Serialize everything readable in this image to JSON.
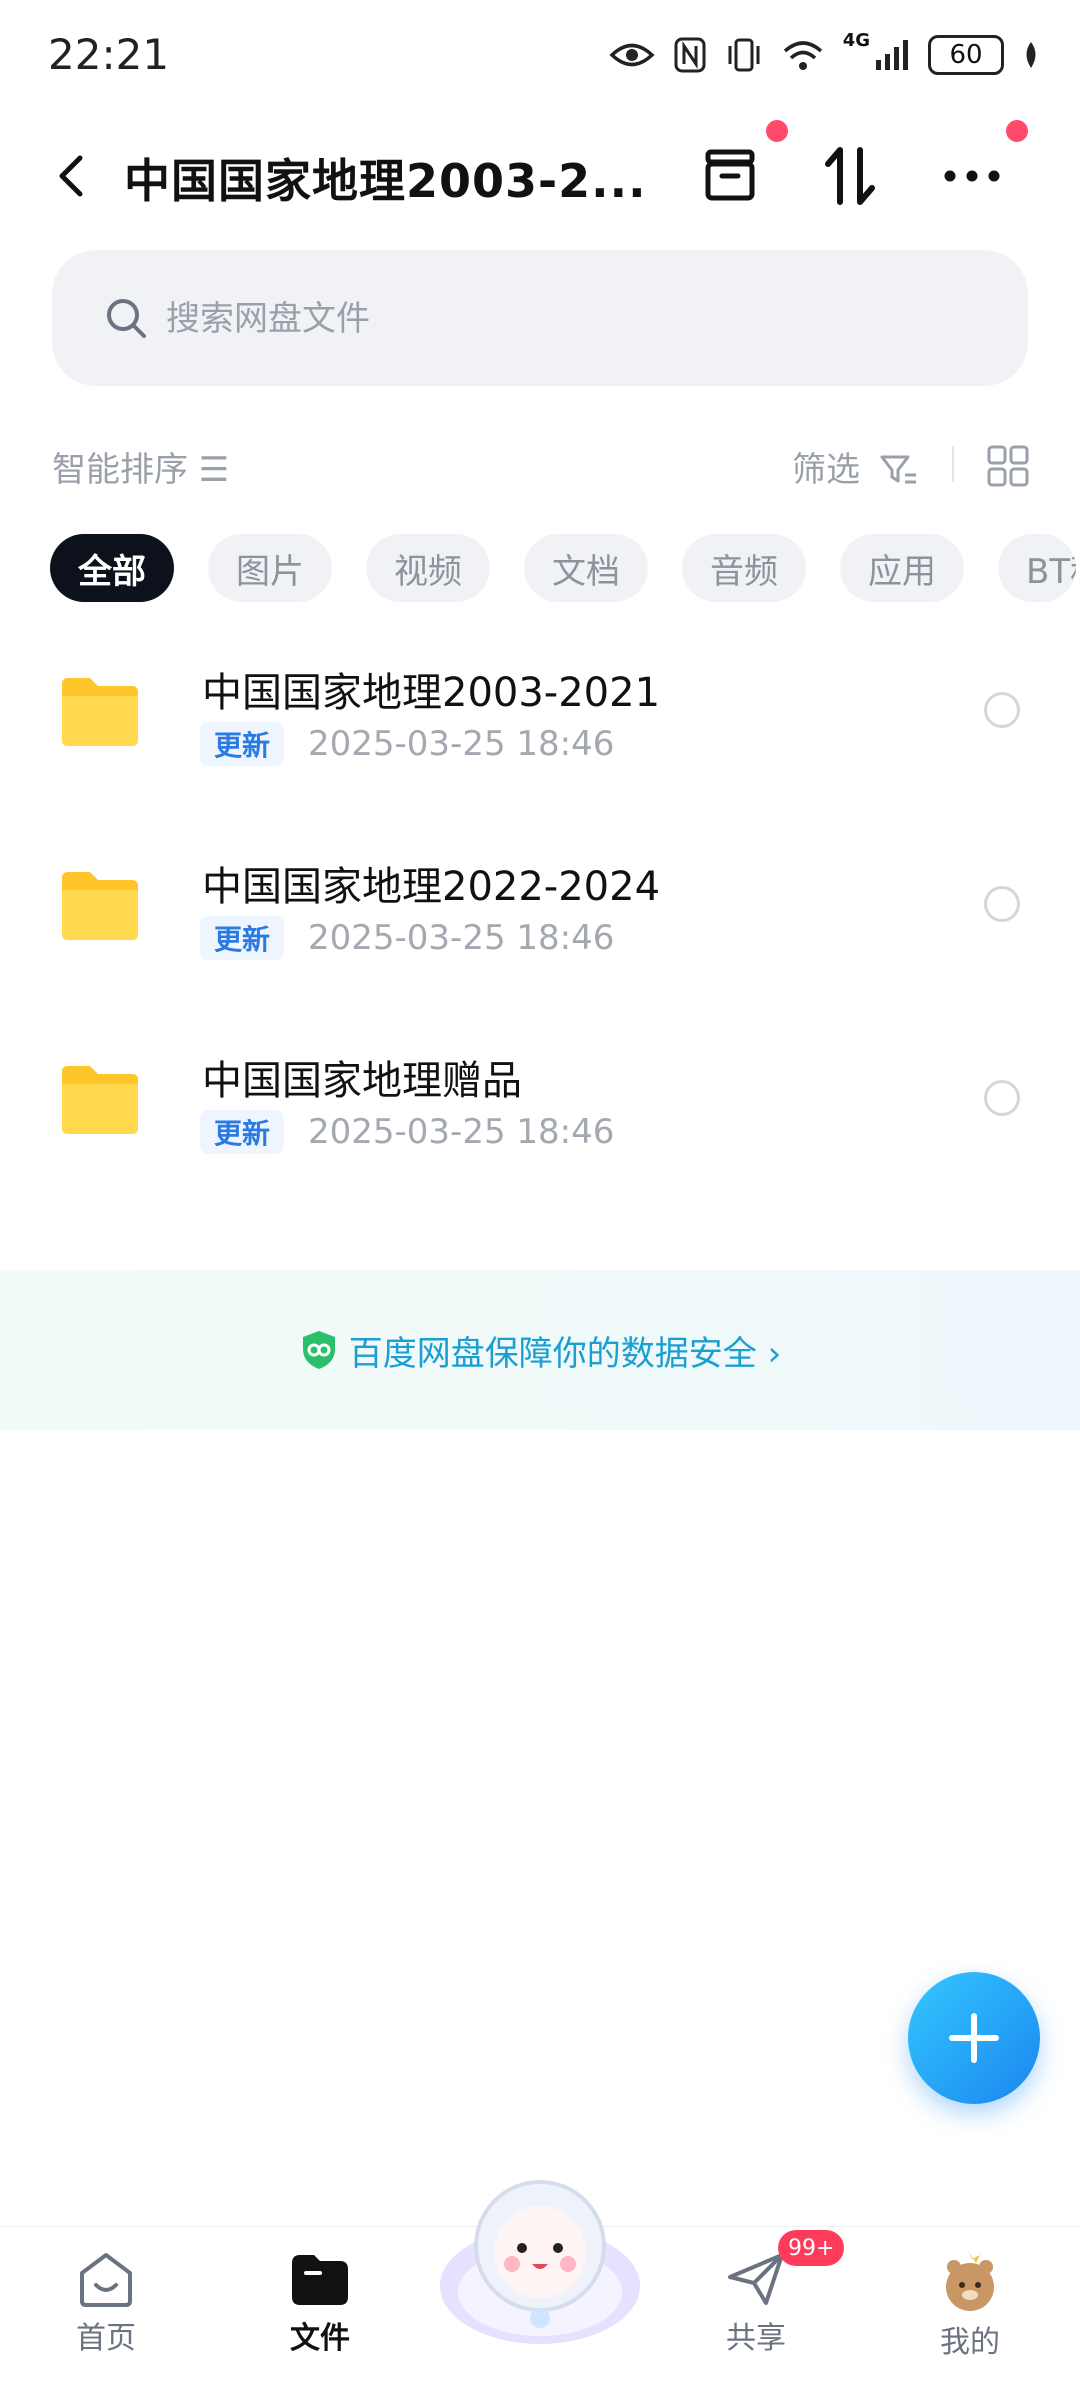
{
  "status_bar": {
    "time": "22:21",
    "network": "4G",
    "battery": "60"
  },
  "header": {
    "title": "中国国家地理2003-2..."
  },
  "search": {
    "placeholder": "搜索网盘文件"
  },
  "toolbar": {
    "sort_label": "智能排序 ☰",
    "filter_label": "筛选"
  },
  "chips": [
    {
      "label": "全部",
      "active": true
    },
    {
      "label": "图片"
    },
    {
      "label": "视频"
    },
    {
      "label": "文档"
    },
    {
      "label": "音频"
    },
    {
      "label": "应用"
    },
    {
      "label": "BT种"
    }
  ],
  "files": [
    {
      "name": "中国国家地理2003-2021",
      "badge": "更新",
      "date": "2025-03-25  18:46"
    },
    {
      "name": "中国国家地理2022-2024",
      "badge": "更新",
      "date": "2025-03-25  18:46"
    },
    {
      "name": "中国国家地理赠品",
      "badge": "更新",
      "date": "2025-03-25  18:46"
    }
  ],
  "security_banner": {
    "text": "百度网盘保障你的数据安全 ›"
  },
  "bottom_nav": {
    "home": "首页",
    "files": "文件",
    "share": "共享",
    "share_badge": "99+",
    "mine": "我的"
  },
  "colors": {
    "accent": "#1a86f0",
    "folder": "#ffc62c",
    "badge_red": "#ff3b5c"
  }
}
